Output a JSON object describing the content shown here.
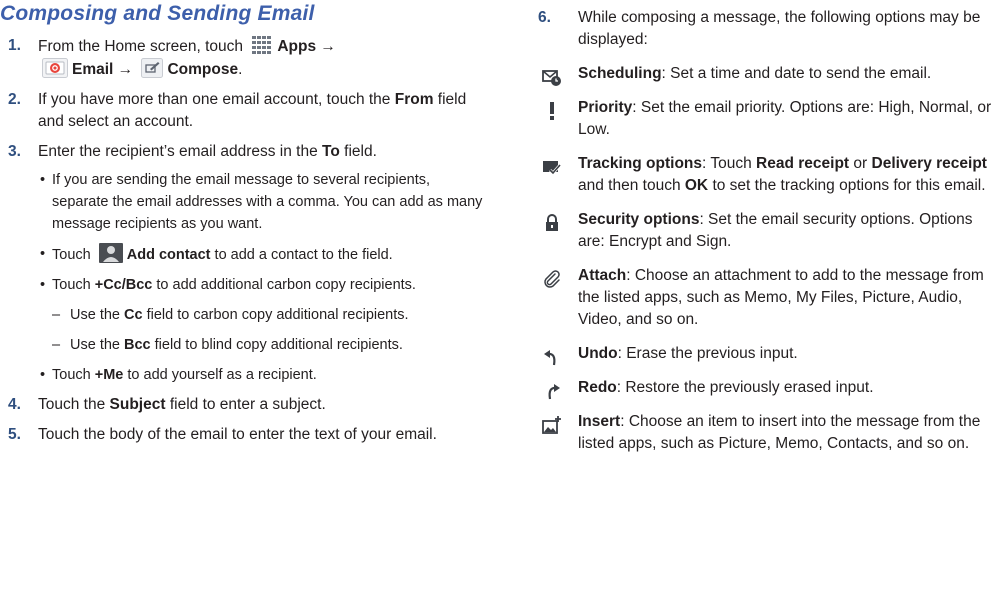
{
  "title": "Composing and Sending Email",
  "left": {
    "steps": [
      {
        "num": "1.",
        "pre": "From the Home screen, touch",
        "apps": "Apps",
        "arrow1": "→",
        "email": "Email",
        "arrow2": "→",
        "compose": "Compose",
        "end": "."
      },
      {
        "num": "2.",
        "pre": "If you have more than one email account, touch the",
        "bold": "From",
        "post": "field and select an account."
      },
      {
        "num": "3.",
        "pre": "Enter the recipient’s email address in the",
        "bold": "To",
        "post": "field."
      },
      {
        "num": "4.",
        "pre": "Touch the",
        "bold": "Subject",
        "post": "field to enter a subject."
      },
      {
        "num": "5.",
        "text": "Touch the body of the email to enter the text of your email."
      }
    ],
    "bullets": {
      "several": "If you are sending the email message to several recipients, separate the email addresses with a comma. You can add as many message recipients as you want.",
      "add_pre": "Touch",
      "add_bold": "Add contact",
      "add_post": "to add a contact to the field.",
      "cc_pre": "Touch",
      "cc_bold": "+Cc/Bcc",
      "cc_post": "to add additional carbon copy recipients.",
      "use_cc_pre": "Use the",
      "use_cc_bold": "Cc",
      "use_cc_post": "field to carbon copy additional recipients.",
      "use_bcc_pre": "Use the",
      "use_bcc_bold": "Bcc",
      "use_bcc_post": "field to blind copy additional recipients.",
      "me_pre": "Touch",
      "me_bold": "+Me",
      "me_post": "to add yourself as a recipient."
    }
  },
  "right": {
    "num": "6.",
    "intro": "While composing a message, the following options may be displayed:",
    "options": {
      "scheduling": {
        "name": "Scheduling",
        "desc": ": Set a time and date to send the email.",
        "icon": "scheduling-icon"
      },
      "priority": {
        "name": "Priority",
        "desc": ": Set the email priority. Options are: High, Normal, or Low.",
        "icon": "priority-icon"
      },
      "tracking": {
        "name": "Tracking options",
        "t1": ": Touch",
        "b1": "Read receipt",
        "t2": "or",
        "b2": "Delivery receipt",
        "t3": "and then touch",
        "b3": "OK",
        "t4": "to set the tracking options for this email.",
        "icon": "tracking-icon"
      },
      "security": {
        "name": "Security options",
        "desc": ": Set the email security options. Options are: Encrypt and Sign.",
        "icon": "lock-icon"
      },
      "attach": {
        "name": "Attach",
        "desc": ": Choose an attachment to add to the message from the listed apps, such as Memo, My Files, Picture, Audio, Video, and so on.",
        "icon": "paperclip-icon"
      },
      "undo": {
        "name": "Undo",
        "desc": ": Erase the previous input.",
        "icon": "undo-icon"
      },
      "redo": {
        "name": "Redo",
        "desc": ": Restore the previously erased input.",
        "icon": "redo-icon"
      },
      "insert": {
        "name": "Insert",
        "desc": ": Choose an item to insert into the message from the listed apps, such as Picture, Memo, Contacts, and so on.",
        "icon": "insert-image-icon"
      }
    }
  },
  "colors": {
    "title": "#3d5fab",
    "step_number": "#2f4f7f",
    "text": "#231f20"
  }
}
